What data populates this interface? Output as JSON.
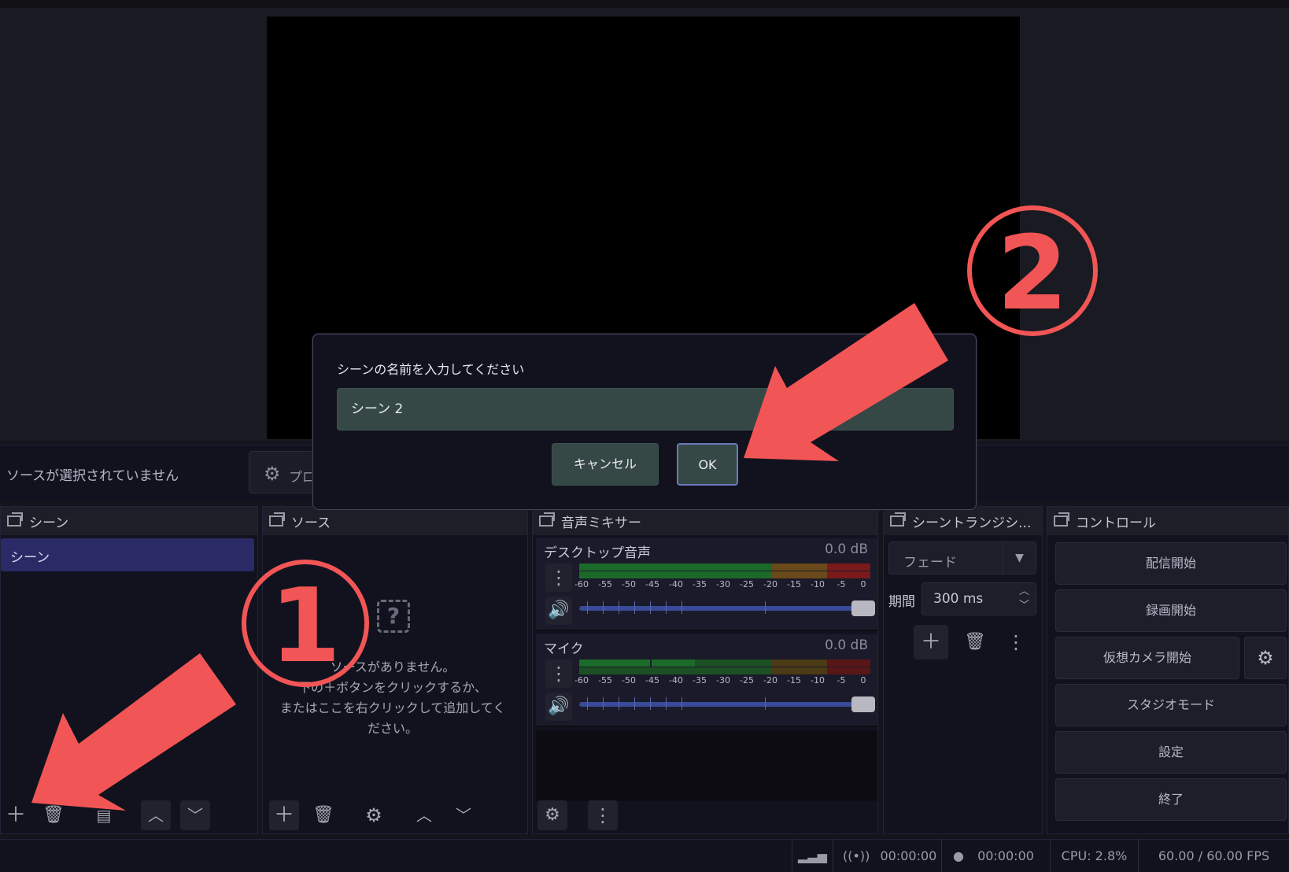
{
  "preview": {
    "canvas": "black"
  },
  "properties_bar": {
    "no_source_text": "ソースが選択されていません",
    "properties_button_label": "プロ"
  },
  "docks": {
    "scenes": {
      "title": "シーン",
      "items": [
        "シーン"
      ]
    },
    "sources": {
      "title": "ソース",
      "empty_line1": "ソースがありません。",
      "empty_line2": "下の＋ボタンをクリックするか、",
      "empty_line3": "またはここを右クリックして追加してく",
      "empty_line4": "ださい。"
    },
    "mixer": {
      "title": "音声ミキサー",
      "channels": [
        {
          "name": "デスクトップ音声",
          "level": "0.0 dB"
        },
        {
          "name": "マイク",
          "level": "0.0 dB"
        }
      ],
      "ticks": [
        "-60",
        "-55",
        "-50",
        "-45",
        "-40",
        "-35",
        "-30",
        "-25",
        "-20",
        "-15",
        "-10",
        "-5",
        "0"
      ]
    },
    "transitions": {
      "title": "シーントランジシ...",
      "selected": "フェード",
      "duration_label": "期間",
      "duration_value": "300 ms"
    },
    "controls": {
      "title": "コントロール",
      "buttons": [
        "配信開始",
        "録画開始",
        "仮想カメラ開始",
        "スタジオモード",
        "設定",
        "終了"
      ]
    }
  },
  "status_bar": {
    "stream_time": "00:00:00",
    "rec_time": "00:00:00",
    "cpu": "CPU: 2.8%",
    "fps": "60.00 / 60.00 FPS"
  },
  "dialog": {
    "prompt": "シーンの名前を入力してください",
    "input_value": "シーン 2",
    "cancel_label": "キャンセル",
    "ok_label": "OK"
  },
  "annotations": {
    "step1": "①",
    "step2": "②",
    "color": "#f25555"
  }
}
